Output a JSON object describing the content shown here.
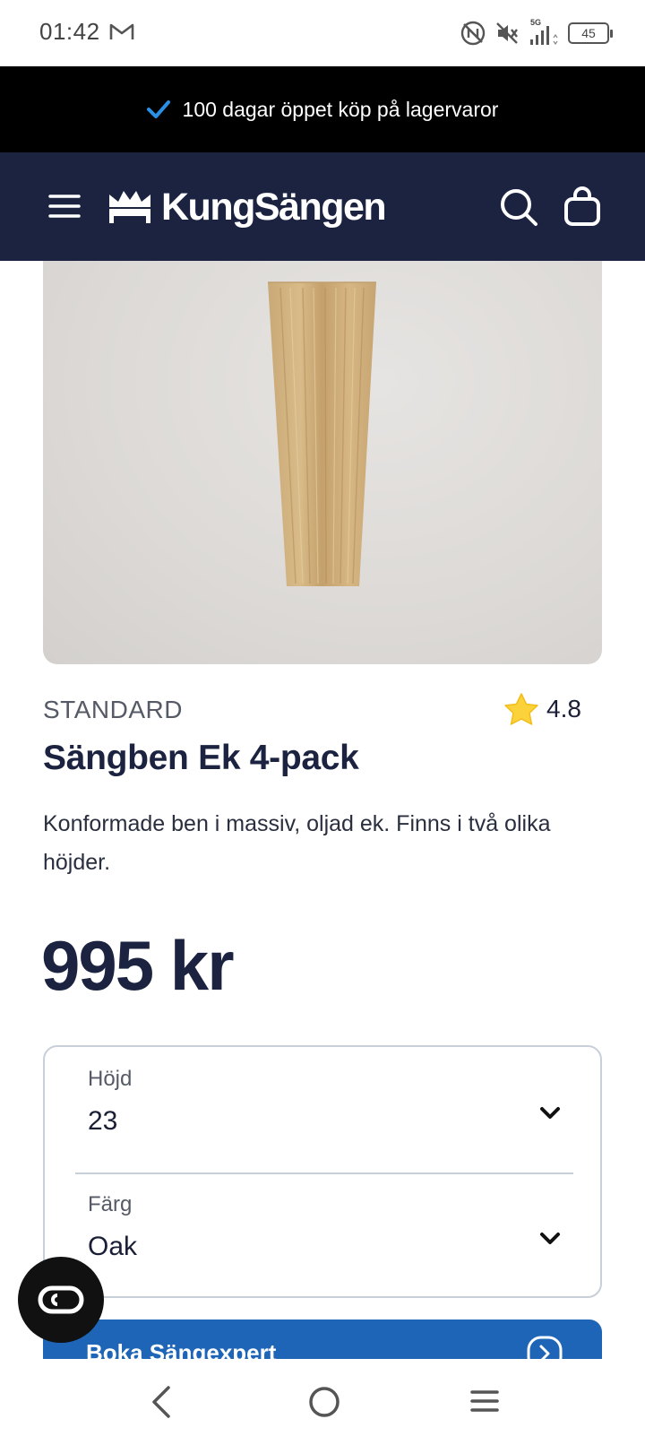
{
  "status_bar": {
    "time": "01:42",
    "network": "5G",
    "battery": "45"
  },
  "promo": {
    "text": "100 dagar öppet köp på lagervaror"
  },
  "header": {
    "logo_text": "KungSängen"
  },
  "product": {
    "brand": "STANDARD",
    "rating": "4.8",
    "title": "Sängben Ek 4-pack",
    "description": "Konformade ben i massiv, oljad ek. Finns i två olika höjder.",
    "price": "995 kr"
  },
  "options": [
    {
      "label": "Höjd",
      "value": "23"
    },
    {
      "label": "Färg",
      "value": "Oak"
    }
  ],
  "cta": {
    "label": "Boka Sängexpert"
  },
  "colors": {
    "header_bg": "#1b2340",
    "promo_bg": "#000000",
    "cta_bg": "#1e65b7",
    "check": "#2b8fe6",
    "star": "#fcd23a"
  },
  "icons": {
    "promo": "check-icon",
    "menu": "hamburger-icon",
    "search": "search-icon",
    "cart": "shopping-bag-icon",
    "rating": "star-icon",
    "chevron": "chevron-down-icon",
    "chat": "chat-icon"
  }
}
